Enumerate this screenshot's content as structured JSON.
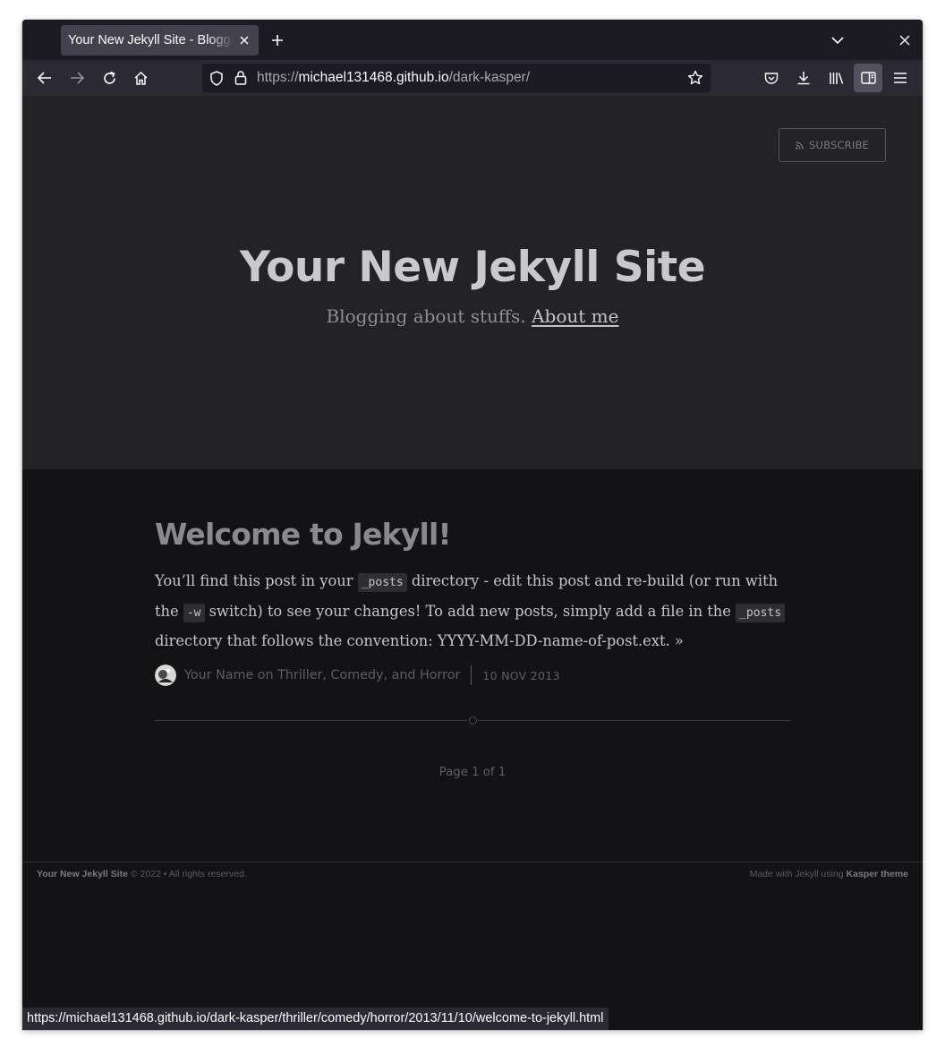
{
  "browser": {
    "tab_title": "Your New Jekyll Site - Blogging about stuffs.",
    "url_scheme": "https://",
    "url_host": "michael131468.github.io",
    "url_path": "/dark-kasper/",
    "status_url": "https://michael131468.github.io/dark-kasper/thriller/comedy/horror/2013/11/10/welcome-to-jekyll.html"
  },
  "header": {
    "subscribe_label": "SUBSCRIBE",
    "site_title": "Your New Jekyll Site",
    "description": "Blogging about stuffs.",
    "about_link": "About me"
  },
  "post": {
    "title": "Welcome to Jekyll!",
    "excerpt_1": "You’ll find this post in your ",
    "code_1": "_posts",
    "excerpt_2": " directory - edit this post and re-build (or run with the ",
    "code_2": "-w",
    "excerpt_3": " switch) to see your changes! To add new posts, simply add a file in the ",
    "code_3": "_posts",
    "excerpt_4": " directory that follows the convention: YYYY-MM-DD-name-of-post.ext. ",
    "read_more": "»",
    "author": "Your Name on Thriller, Comedy, and Horror",
    "date": "10 NOV 2013"
  },
  "pagination": "Page 1 of 1",
  "footer": {
    "site_name": "Your New Jekyll Site",
    "copyright": " © 2022 • All rights reserved.",
    "made_with": "Made with Jekyll using ",
    "theme": "Kasper theme"
  },
  "colors": {
    "hero_bg": "#232325",
    "page_bg": "#131315",
    "chrome_bg": "#2b2a33"
  }
}
